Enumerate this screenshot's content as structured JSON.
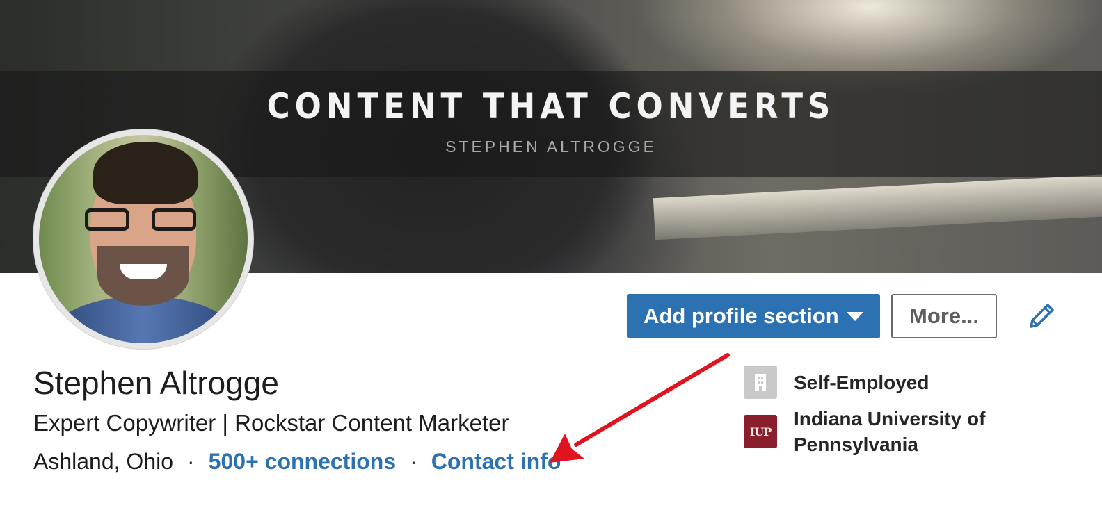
{
  "banner": {
    "headline": "CONTENT THAT CONVERTS",
    "byline": "STEPHEN ALTROGGE"
  },
  "profile": {
    "name": "Stephen Altrogge",
    "headline": "Expert Copywriter | Rockstar Content Marketer",
    "location": "Ashland, Ohio",
    "separator": "·",
    "connections": "500+ connections",
    "contact_info": "Contact info"
  },
  "actions": {
    "add_section_label": "Add profile section",
    "more_label": "More..."
  },
  "experience": [
    {
      "label": "Self-Employed",
      "icon": "building-icon"
    },
    {
      "label": "Indiana University of Pennsylvania",
      "logo_text": "IUP"
    }
  ],
  "colors": {
    "accent": "#2c71b1",
    "annotation_arrow": "#e0141e",
    "school_logo": "#8b1e2c"
  }
}
